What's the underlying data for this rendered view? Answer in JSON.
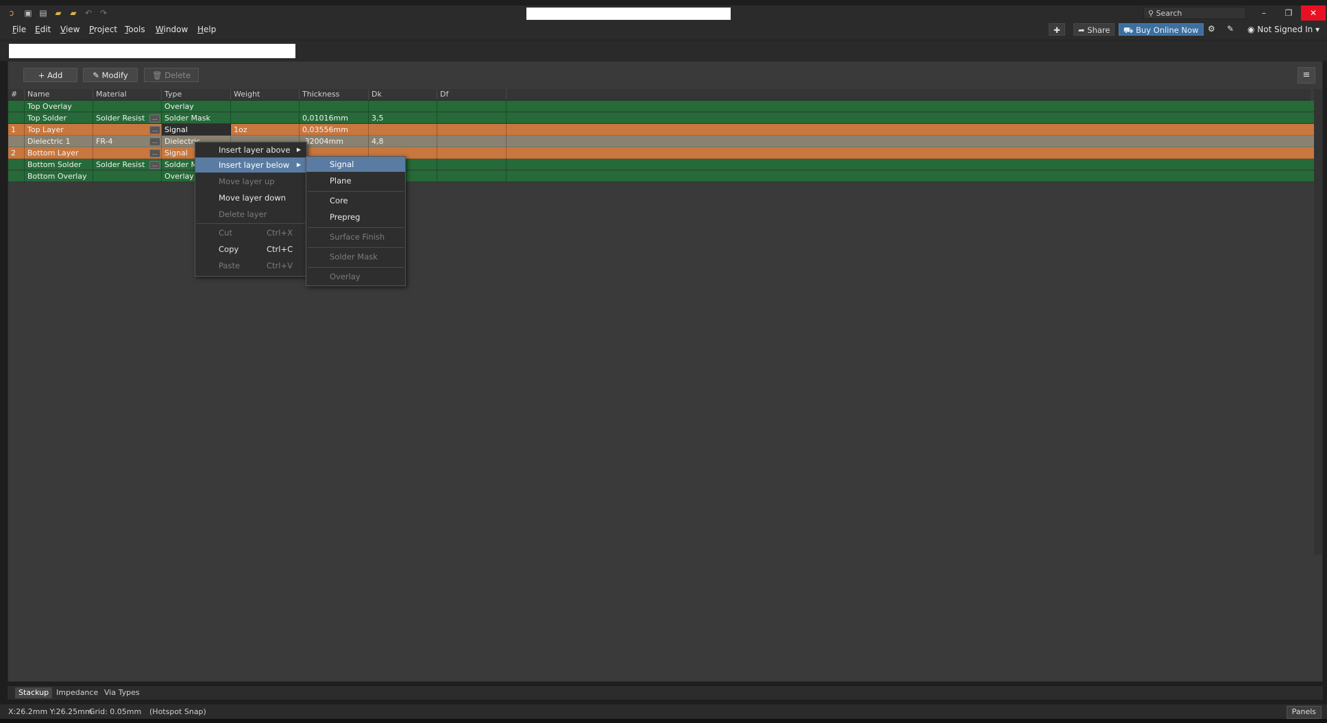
{
  "menubar": {
    "items": [
      {
        "label": "File",
        "ul": "F",
        "rest": "ile"
      },
      {
        "label": "Edit",
        "ul": "E",
        "rest": "dit"
      },
      {
        "label": "View",
        "ul": "V",
        "rest": "iew"
      },
      {
        "label": "Project",
        "ul": "P",
        "rest": "roject"
      },
      {
        "label": "Tools",
        "ul": "T",
        "rest": "ools"
      },
      {
        "label": "Window",
        "ul": "W",
        "rest": "indow"
      },
      {
        "label": "Help",
        "ul": "H",
        "rest": "elp"
      }
    ],
    "share": "Share",
    "buy": "Buy Online Now",
    "account": "Not Signed In"
  },
  "titlebar": {
    "search_placeholder": "Search"
  },
  "toolbar": {
    "add": "+ Add",
    "modify": "Modify",
    "delete": "Delete"
  },
  "table": {
    "headers": [
      "#",
      "Name",
      "Material",
      "Type",
      "Weight",
      "Thickness",
      "Dk",
      "Df"
    ],
    "rows": [
      {
        "num": "",
        "name": "Top Overlay",
        "material": "",
        "type": "Overlay",
        "weight": "",
        "thickness": "",
        "dk": "",
        "color": "green",
        "matbtn": false
      },
      {
        "num": "",
        "name": "Top Solder",
        "material": "Solder Resist",
        "type": "Solder Mask",
        "weight": "",
        "thickness": "0,01016mm",
        "dk": "3,5",
        "color": "green",
        "matbtn": true
      },
      {
        "num": "1",
        "name": "Top Layer",
        "material": "",
        "type": "Signal",
        "weight": "1oz",
        "thickness": "0,03556mm",
        "dk": "",
        "color": "orange",
        "matbtn": true
      },
      {
        "num": "",
        "name": "Dielectric 1",
        "material": "FR-4",
        "type": "Dielectric",
        "weight": "",
        "thickness": ",32004mm",
        "dk": "4,8",
        "color": "tan",
        "matbtn": true
      },
      {
        "num": "2",
        "name": "Bottom Layer",
        "material": "",
        "type": "Signal",
        "weight": "",
        "thickness": "",
        "dk": "",
        "color": "orange",
        "matbtn": true
      },
      {
        "num": "",
        "name": "Bottom Solder",
        "material": "Solder Resist",
        "type": "Solder Mask",
        "weight": "",
        "thickness": "",
        "dk": "",
        "color": "green",
        "matbtn": true
      },
      {
        "num": "",
        "name": "Bottom Overlay",
        "material": "",
        "type": "Overlay",
        "weight": "",
        "thickness": "",
        "dk": "",
        "color": "green",
        "matbtn": false
      }
    ]
  },
  "context_menu": {
    "items": [
      {
        "label": "Insert layer above",
        "submenu": true,
        "disabled": false
      },
      {
        "label": "Insert layer below",
        "submenu": true,
        "disabled": false,
        "active": true
      },
      {
        "label": "Move layer up",
        "disabled": true
      },
      {
        "label": "Move layer down",
        "disabled": false
      },
      {
        "label": "Delete layer",
        "disabled": true
      },
      {
        "label": "Cut",
        "shortcut": "Ctrl+X",
        "disabled": true
      },
      {
        "label": "Copy",
        "shortcut": "Ctrl+C",
        "disabled": false
      },
      {
        "label": "Paste",
        "shortcut": "Ctrl+V",
        "disabled": true
      }
    ]
  },
  "submenu": {
    "items": [
      {
        "label": "Signal",
        "disabled": false,
        "active": true
      },
      {
        "label": "Plane",
        "disabled": false
      },
      {
        "label": "Core",
        "disabled": false
      },
      {
        "label": "Prepreg",
        "disabled": false
      },
      {
        "label": "Surface Finish",
        "disabled": true
      },
      {
        "label": "Solder Mask",
        "disabled": true
      },
      {
        "label": "Overlay",
        "disabled": true
      }
    ]
  },
  "bottom_tabs": [
    "Stackup",
    "Impedance",
    "Via Types"
  ],
  "status": {
    "coords": "X:26.2mm Y:26.25mm",
    "grid": "Grid: 0.05mm",
    "snap": "(Hotspot Snap)",
    "panels": "Panels"
  },
  "colors": {
    "green": "#256a38",
    "orange": "#c8773f",
    "tan": "#8a8270",
    "accent": "#5a7ca3",
    "close": "#e81123"
  }
}
